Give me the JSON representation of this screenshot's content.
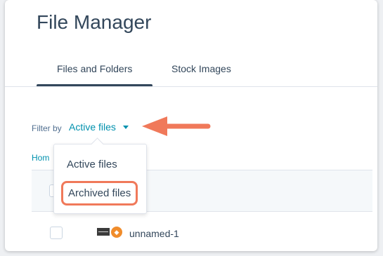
{
  "header": {
    "title": "File Manager"
  },
  "tabs": [
    {
      "label": "Files and Folders",
      "selected": true
    },
    {
      "label": "Stock Images",
      "selected": false
    }
  ],
  "filter": {
    "label": "Filter by",
    "selected": "Active files",
    "options": [
      "Active files",
      "Archived files"
    ],
    "highlighted_option": "Archived files"
  },
  "breadcrumb": {
    "text": "Hom"
  },
  "files": [
    {
      "name": "unnamed-1"
    }
  ],
  "colors": {
    "accent": "#0091ae",
    "annotation": "#f0795a",
    "text": "#33475b"
  }
}
